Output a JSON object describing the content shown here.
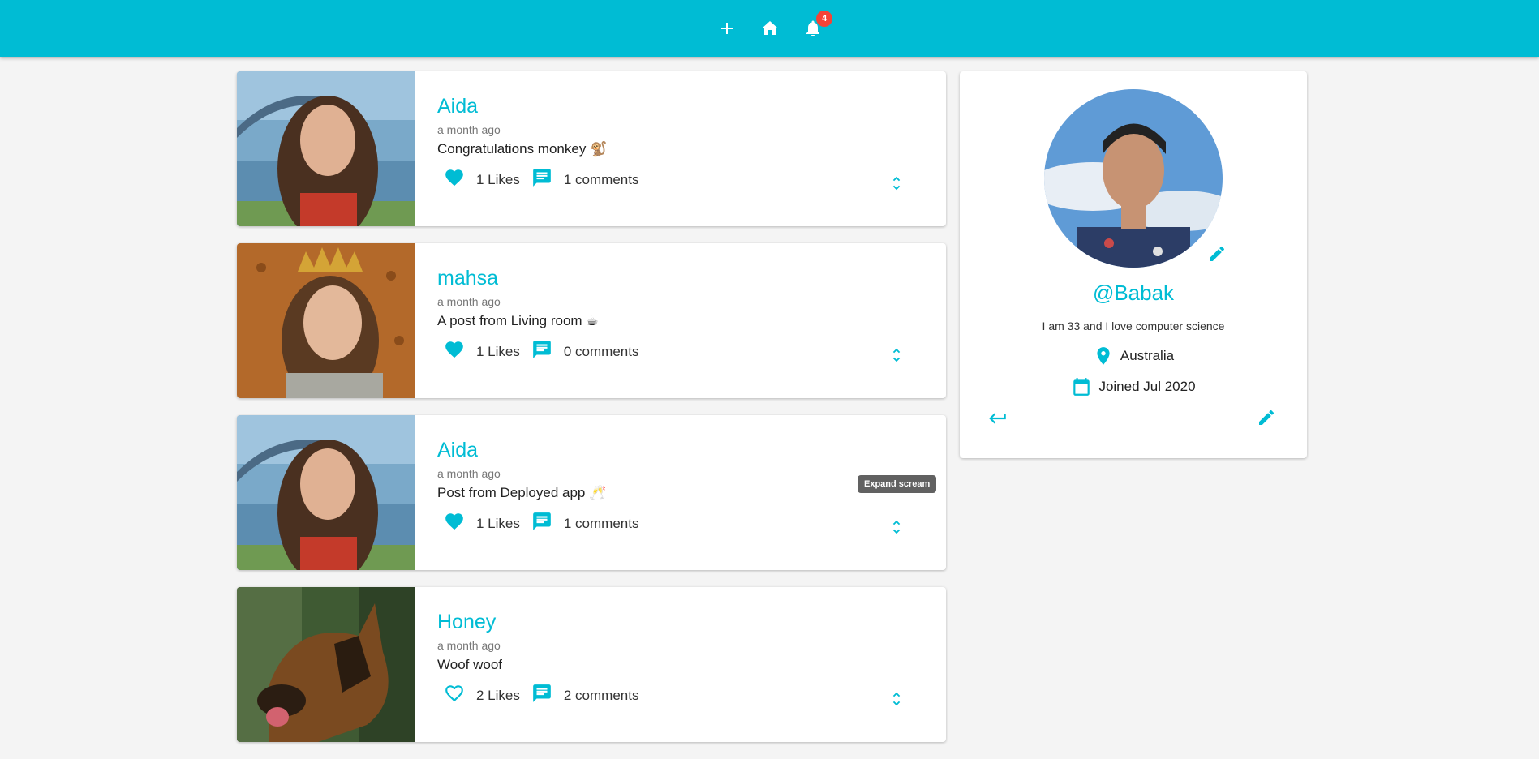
{
  "header": {
    "notification_count": "4",
    "icons": [
      "add-icon",
      "home-icon",
      "bell-icon"
    ]
  },
  "posts": [
    {
      "user": "Aida",
      "time": "a month ago",
      "body": "Congratulations monkey",
      "emoji": "🐒",
      "likes": "1 Likes",
      "comments": "1 comments",
      "liked": true
    },
    {
      "user": "mahsa",
      "time": "a month ago",
      "body": "A post from Living room",
      "emoji": "☕",
      "likes": "1 Likes",
      "comments": "0 comments",
      "liked": true
    },
    {
      "user": "Aida",
      "time": "a month ago",
      "body": "Post from Deployed app",
      "emoji": "🥂",
      "likes": "1 Likes",
      "comments": "1 comments",
      "liked": true
    },
    {
      "user": "Honey",
      "time": "a month ago",
      "body": "Woof woof",
      "emoji": "",
      "likes": "2 Likes",
      "comments": "2 comments",
      "liked": false
    }
  ],
  "tooltip": "Expand scream",
  "profile": {
    "handle": "@Babak",
    "bio": "I am 33 and I love computer science",
    "location": "Australia",
    "joined": "Joined Jul 2020"
  },
  "colors": {
    "primary": "#00bcd4",
    "badge": "#f44336",
    "background": "#f4f4f4"
  }
}
